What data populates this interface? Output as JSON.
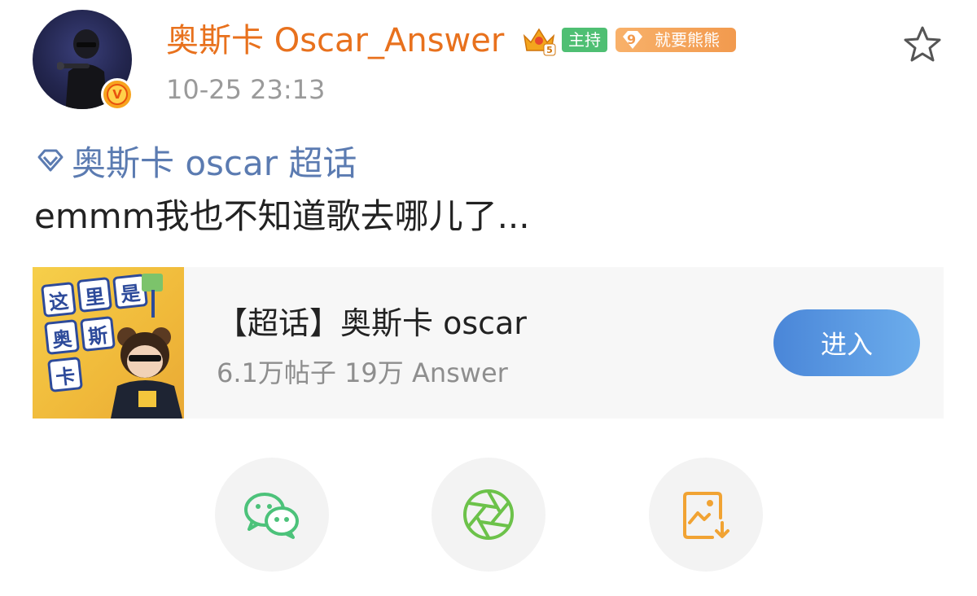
{
  "post": {
    "username": "奥斯卡 Oscar_Answer",
    "timestamp": "10-25 23:13",
    "badges": {
      "crown_level": "5",
      "host_label": "主持",
      "fan_level": "9",
      "fan_name": "就要熊熊"
    },
    "topic_link": "奥斯卡 oscar 超话",
    "text": "emmm我也不知道歌去哪儿了..."
  },
  "topic_card": {
    "title": "【超话】奥斯卡 oscar",
    "meta": "6.1万帖子 19万 Answer",
    "enter_label": "进入",
    "thumb_tiles": [
      "这",
      "里",
      "是",
      "奥",
      "斯",
      "卡"
    ]
  },
  "share": {
    "items": [
      {
        "name": "wechat",
        "icon": "wechat-icon",
        "color": "#4cc27a"
      },
      {
        "name": "moments",
        "icon": "moments-shutter-icon",
        "color": "#6cc24a"
      },
      {
        "name": "save-image",
        "icon": "save-image-icon",
        "color": "#f1a333"
      }
    ]
  },
  "colors": {
    "username": "#e8711d",
    "topic_link": "#5b7bb1",
    "host_badge": "#4fbf73",
    "fan_badge": "#f29a4e",
    "enter_button": "#4a86d8"
  }
}
